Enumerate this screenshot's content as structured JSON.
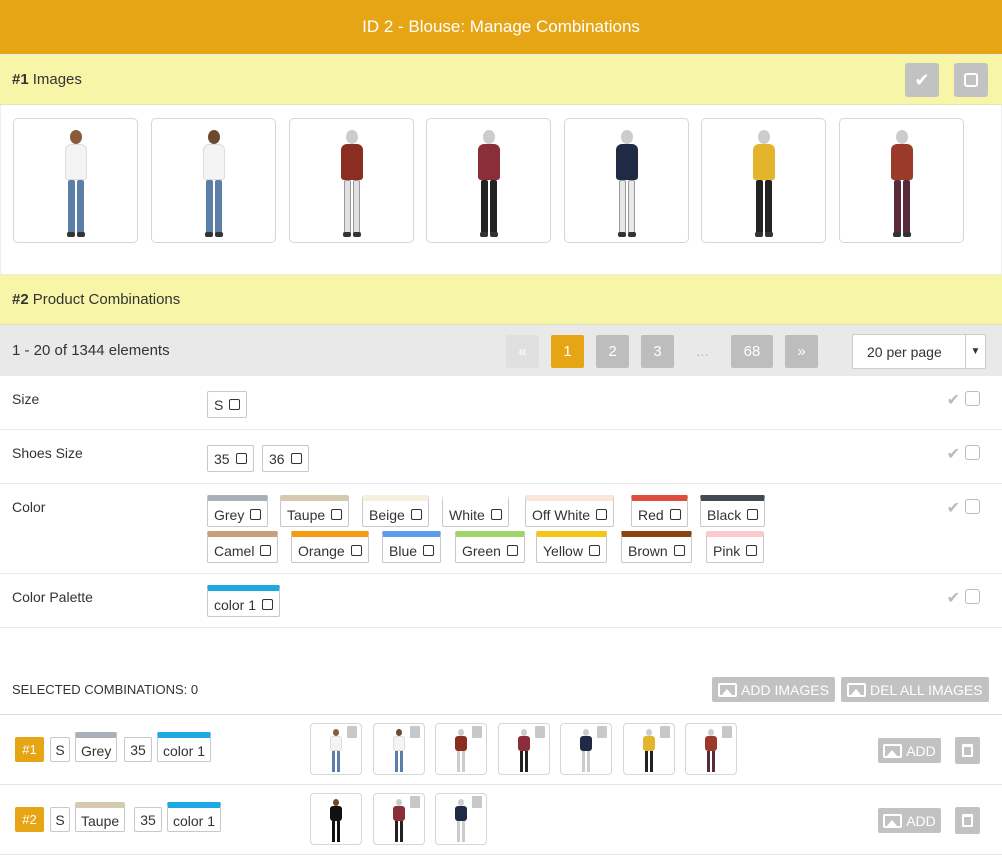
{
  "header": {
    "title": "ID 2 - Blouse: Manage Combinations"
  },
  "images_section": {
    "num": "#1",
    "label": "Images"
  },
  "combos_section": {
    "num": "#2",
    "label": "Product Combinations"
  },
  "pagination": {
    "count_text": "1 - 20 of 1344 elements",
    "first": "«",
    "pages": [
      "1",
      "2",
      "3"
    ],
    "ellipsis": "...",
    "last_page": "68",
    "next": "»",
    "per_page": "20 per page",
    "active_page": "1"
  },
  "attributes": [
    {
      "name": "Size",
      "values": [
        "S"
      ]
    },
    {
      "name": "Shoes Size",
      "values": [
        "35",
        "36"
      ]
    },
    {
      "name": "Color",
      "values": [
        "Grey",
        "Taupe",
        "Beige",
        "White",
        "Off White",
        "Red",
        "Black",
        "Camel",
        "Orange",
        "Blue",
        "Green",
        "Yellow",
        "Brown",
        "Pink"
      ]
    },
    {
      "name": "Color Palette",
      "values": [
        "color 1"
      ]
    }
  ],
  "colors": {
    "accent": "#e6a514",
    "section_bg": "#f7f6a8",
    "Grey": "#aab0ba",
    "Taupe": "#d5c9b0",
    "Beige": "#f5f1de",
    "White": "#ffffff",
    "Off White": "#fbe6dc",
    "Red": "#e04c40",
    "Black": "#434a54",
    "Camel": "#c5a07a",
    "Orange": "#f39c12",
    "Blue": "#5d9ceb",
    "Green": "#a0d468",
    "Yellow": "#f5c518",
    "Brown": "#8b4513",
    "Pink": "#fcc9cf",
    "color 1": "#1ea9e0"
  },
  "selected": {
    "title": "SELECTED COMBINATIONS: 0",
    "add_images": "ADD IMAGES",
    "del_all_images": "DEL ALL IMAGES",
    "rows": [
      {
        "num": "#1",
        "size": "S",
        "color": "Grey",
        "shoe": "35",
        "palette": "color 1",
        "add": "ADD"
      },
      {
        "num": "#2",
        "size": "S",
        "color": "Taupe",
        "shoe": "35",
        "palette": "color 1",
        "add": "ADD"
      }
    ]
  },
  "icons": [
    "check-icon",
    "square-icon",
    "image-icon",
    "trash-icon",
    "chevron-down-icon"
  ]
}
